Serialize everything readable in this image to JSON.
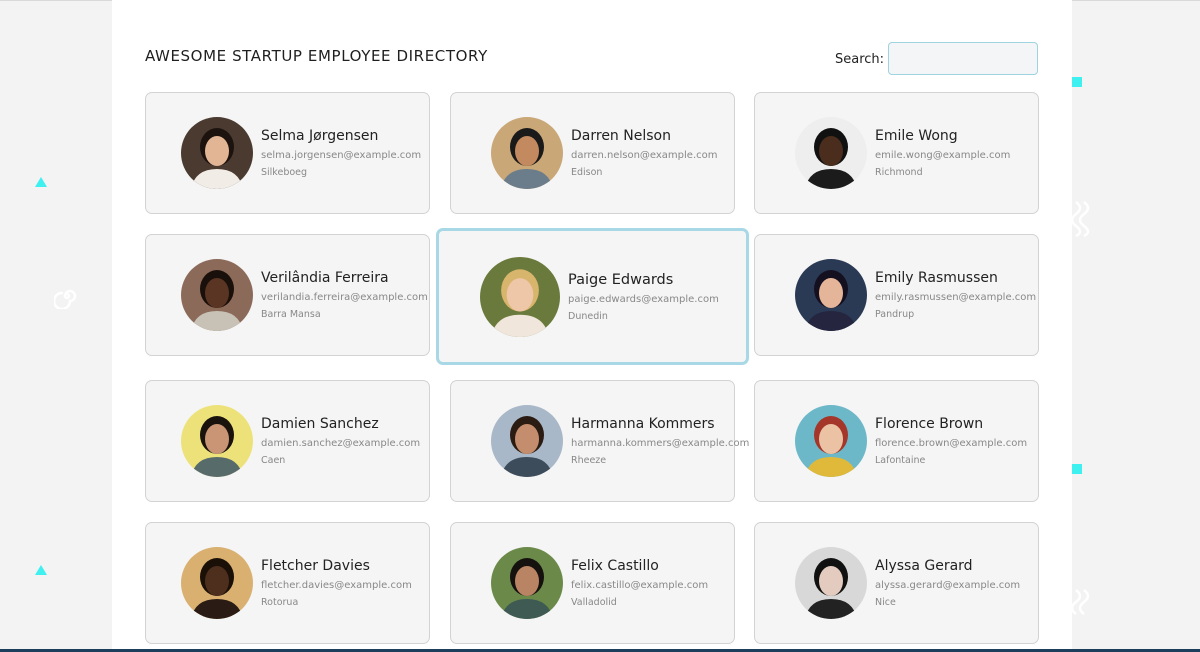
{
  "header": {
    "title": "AWESOME STARTUP EMPLOYEE DIRECTORY",
    "search_label": "Search:",
    "search_value": "",
    "search_placeholder": ""
  },
  "colors": {
    "accent": "#3ef0f0",
    "highlight_border": "#a8d8e5",
    "footer_bar": "#1b3f5c"
  },
  "employees": [
    {
      "name": "Selma Jørgensen",
      "email": "selma.jorgensen@example.com",
      "city": "Silkeboeg",
      "avatar_bg": "#4a3a30",
      "skin": "#e2b594",
      "hair": "#1c130f",
      "shirt": "#f1ece6"
    },
    {
      "name": "Darren Nelson",
      "email": "darren.nelson@example.com",
      "city": "Edison",
      "avatar_bg": "#c9a777",
      "skin": "#c28a5e",
      "hair": "#1a1a1a",
      "shirt": "#6b7d8b"
    },
    {
      "name": "Emile Wong",
      "email": "emile.wong@example.com",
      "city": "Richmond",
      "avatar_bg": "#eeeeee",
      "skin": "#4a2d1c",
      "hair": "#111111",
      "shirt": "#1b1b1b"
    },
    {
      "name": "Verilândia Ferreira",
      "email": "verilandia.ferreira@example.com",
      "city": "Barra Mansa",
      "avatar_bg": "#8c6a5a",
      "skin": "#5a3523",
      "hair": "#1a100b",
      "shirt": "#c7c2b5"
    },
    {
      "name": "Paige Edwards",
      "email": "paige.edwards@example.com",
      "city": "Dunedin",
      "avatar_bg": "#6a7a3c",
      "skin": "#eec6a8",
      "hair": "#d8b56c",
      "shirt": "#f0e6dc"
    },
    {
      "name": "Emily Rasmussen",
      "email": "emily.rasmussen@example.com",
      "city": "Pandrup",
      "avatar_bg": "#2a3a55",
      "skin": "#e5b599",
      "hair": "#151020",
      "shirt": "#252540"
    },
    {
      "name": "Damien Sanchez",
      "email": "damien.sanchez@example.com",
      "city": "Caen",
      "avatar_bg": "#ede27a",
      "skin": "#c99574",
      "hair": "#1a120d",
      "shirt": "#586b6b"
    },
    {
      "name": "Harmanna Kommers",
      "email": "harmanna.kommers@example.com",
      "city": "Rheeze",
      "avatar_bg": "#a8b8c8",
      "skin": "#c48e6e",
      "hair": "#2b1c13",
      "shirt": "#3d4c5a"
    },
    {
      "name": "Florence Brown",
      "email": "florence.brown@example.com",
      "city": "Lafontaine",
      "avatar_bg": "#6cb8c9",
      "skin": "#ecc2a5",
      "hair": "#a5362a",
      "shirt": "#e0b93a"
    },
    {
      "name": "Fletcher Davies",
      "email": "fletcher.davies@example.com",
      "city": "Rotorua",
      "avatar_bg": "#d9b070",
      "skin": "#4e2e1c",
      "hair": "#1a1008",
      "shirt": "#2a1c14"
    },
    {
      "name": "Felix Castillo",
      "email": "felix.castillo@example.com",
      "city": "Valladolid",
      "avatar_bg": "#6b8a4a",
      "skin": "#b98464",
      "hair": "#15110e",
      "shirt": "#3e5a52"
    },
    {
      "name": "Alyssa Gerard",
      "email": "alyssa.gerard@example.com",
      "city": "Nice",
      "avatar_bg": "#d8d8d8",
      "skin": "#e3ccbf",
      "hair": "#111111",
      "shirt": "#222222"
    }
  ]
}
